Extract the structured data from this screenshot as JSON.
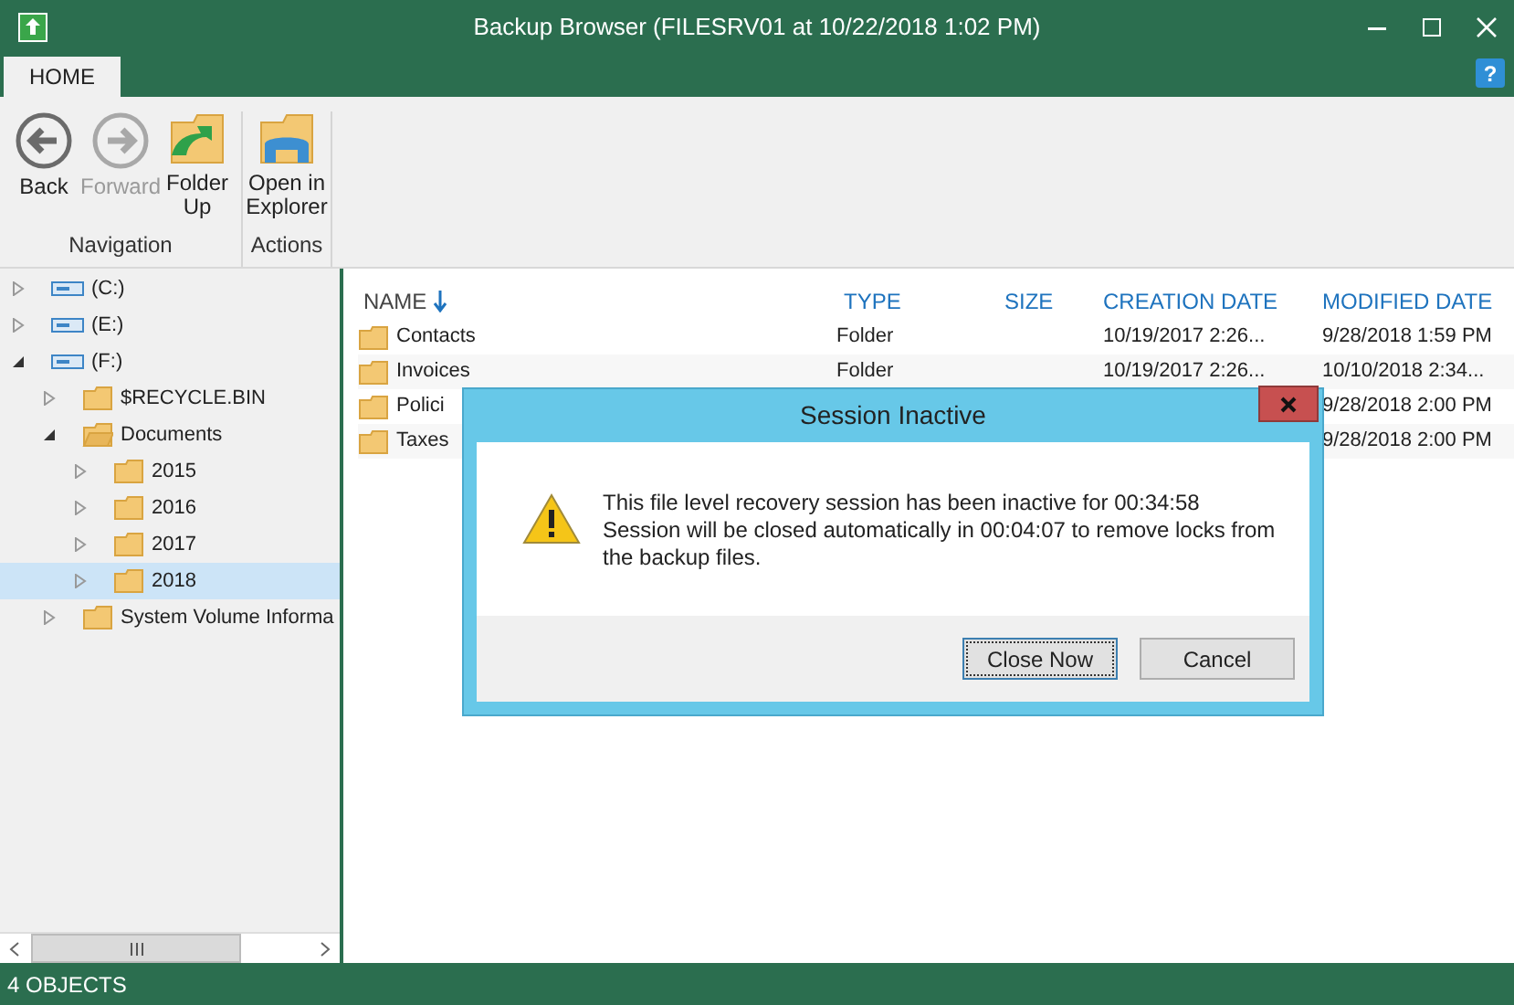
{
  "window": {
    "title": "Backup Browser (FILESRV01 at 10/22/2018 1:02 PM)"
  },
  "tabs": [
    {
      "label": "HOME",
      "selected": true
    }
  ],
  "help": "?",
  "ribbon": {
    "groups": [
      {
        "label": "Navigation",
        "buttons": [
          {
            "kind": "back",
            "label": "Back",
            "disabled": false
          },
          {
            "kind": "forward",
            "label": "Forward",
            "disabled": true
          },
          {
            "kind": "folder-up",
            "label": "Folder Up",
            "disabled": false
          }
        ]
      },
      {
        "label": "Actions",
        "buttons": [
          {
            "kind": "explorer",
            "label": "Open in Explorer",
            "disabled": false
          }
        ]
      }
    ]
  },
  "tree": [
    {
      "kind": "drive",
      "label": "(C:)",
      "expanded": false,
      "selected": false
    },
    {
      "kind": "drive",
      "label": "(E:)",
      "expanded": false,
      "selected": false
    },
    {
      "kind": "drive",
      "label": "(F:)",
      "expanded": true,
      "selected": false,
      "children": [
        {
          "kind": "folder",
          "label": "$RECYCLE.BIN",
          "expanded": false,
          "selected": false
        },
        {
          "kind": "folder",
          "label": "Documents",
          "expanded": true,
          "selected": false,
          "children": [
            {
              "kind": "folder",
              "label": "2015",
              "expanded": false,
              "selected": false
            },
            {
              "kind": "folder",
              "label": "2016",
              "expanded": false,
              "selected": false
            },
            {
              "kind": "folder",
              "label": "2017",
              "expanded": false,
              "selected": false
            },
            {
              "kind": "folder",
              "label": "2018",
              "expanded": false,
              "selected": true
            }
          ]
        },
        {
          "kind": "folder",
          "label": "System Volume Informa",
          "expanded": false,
          "selected": false
        }
      ]
    }
  ],
  "table": {
    "columns": [
      {
        "label": "NAME",
        "sorted": true
      },
      {
        "label": "TYPE",
        "sorted": false
      },
      {
        "label": "SIZE",
        "sorted": false
      },
      {
        "label": "CREATION DATE",
        "sorted": false
      },
      {
        "label": "MODIFIED DATE",
        "sorted": false
      }
    ],
    "rows": [
      {
        "name": "Contacts",
        "type": "Folder",
        "created": "10/19/2017 2:26...",
        "modified": "9/28/2018 1:59 PM"
      },
      {
        "name": "Invoices",
        "type": "Folder",
        "created": "10/19/2017 2:26...",
        "modified": "10/10/2018 2:34..."
      },
      {
        "name": "Polici",
        "modified": "9/28/2018 2:00 PM"
      },
      {
        "name": "Taxes",
        "modified": "9/28/2018 2:00 PM"
      }
    ]
  },
  "dialog": {
    "title": "Session Inactive",
    "message": [
      "This file level recovery session has been inactive for 00:34:58",
      "Session will be closed automatically in 00:04:07 to remove locks from the backup files."
    ],
    "buttons": [
      {
        "label": "Close Now",
        "selected": true
      },
      {
        "label": "Cancel",
        "selected": false
      }
    ]
  },
  "status_bar": "4 OBJECTS"
}
